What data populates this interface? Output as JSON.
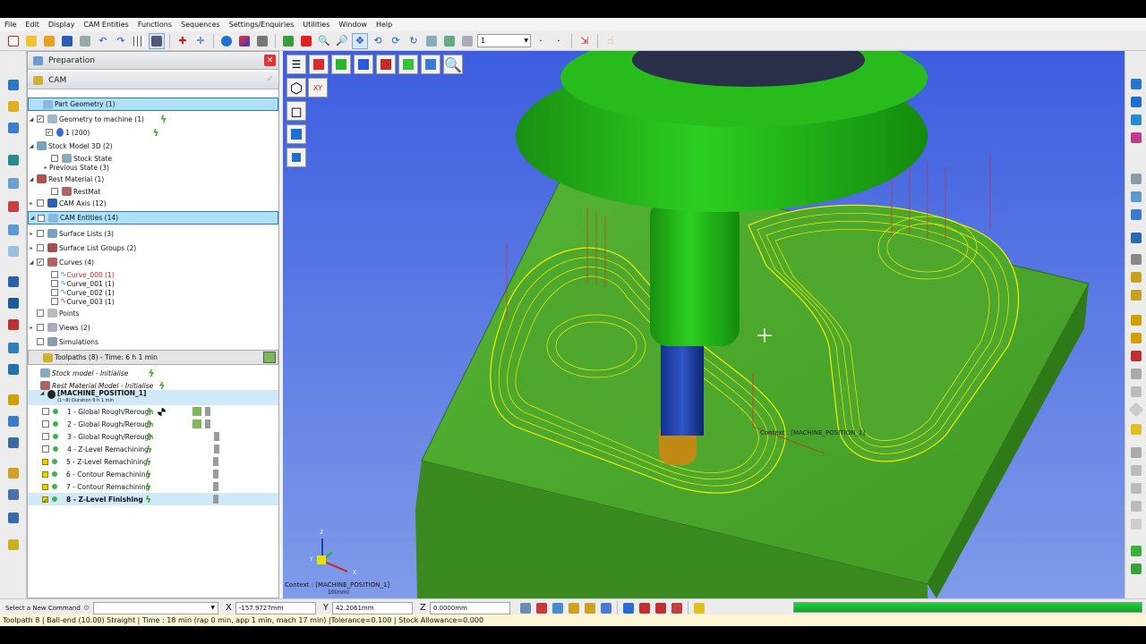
{
  "menu": [
    "File",
    "Edit",
    "Display",
    "CAM Entities",
    "Functions",
    "Sequences",
    "Settings/Enquiries",
    "Utilities",
    "Window",
    "Help"
  ],
  "toolbar": {
    "combo_value": "1"
  },
  "panel": {
    "title": "Preparation",
    "subtitle": "CAM",
    "close_label": "✕",
    "ok_label": "✓"
  },
  "tree": {
    "part_geometry": "Part Geometry (1)",
    "geometry_to_machine": "Geometry to machine (1)",
    "geom_item": "1 (200)",
    "stock_model": "Stock Model 3D (2)",
    "stock_state": "Stock State",
    "previous_state": "Previous State (3)",
    "rest_material": "Rest Material (1)",
    "restmat": "RestMat",
    "cam_axis": "CAM Axis (12)",
    "cam_entities": "CAM Entities (14)",
    "surface_lists": "Surface Lists (3)",
    "surface_list_groups": "Surface List Groups (2)",
    "curves": "Curves (4)",
    "curve_items": [
      "Curve_000 (1)",
      "Curve_001 (1)",
      "Curve_002 (1)",
      "Curve_003 (1)"
    ],
    "points": "Points",
    "views": "Views (2)",
    "simulations": "Simulations",
    "toolpaths": "Toolpaths (8) - Time: 6 h 1 min",
    "stock_init": "Stock model - Initialise",
    "rest_init": "Rest Material Model - Initialise",
    "machine_position": "[MACHINE_POSITION_1]",
    "machine_duration": "(1~8) Duration 6 h 1 min",
    "toolpath_items": [
      "1 - Global Rough/Rerough",
      "2 - Global Rough/Rerough",
      "3 - Global Rough/Rerough",
      "4 - Z-Level Remachining",
      "5 - Z-Level Remachining",
      "6 - Contour Remachining",
      "7 - Contour Remachining",
      "8 - Z-Level Finishing"
    ]
  },
  "viewport": {
    "context_label": "Context : [MACHINE_POSITION_1]",
    "context_label_model": "Context : [MACHINE_POSITION_1]",
    "scale_label": "10(mm)",
    "axis_z": "Z",
    "axis_y": "Y",
    "axis_x": "X",
    "part_color": "#4aa12c",
    "spindle_color": "#22b61a",
    "tool_color": "#1e3fa3",
    "toolpath_color": "#f0f000"
  },
  "command": {
    "label": "Select a New Command",
    "x_label": "X",
    "x_value": "-157.9727mm",
    "y_label": "Y",
    "y_value": "42.2061mm",
    "z_label": "Z",
    "z_value": "0.0000mm",
    "progress_percent": 100
  },
  "status": "Toolpath 8 | Ball-end (10.00) Straight | Time : 18 min (rap 0 min, app 1 min, mach 17 min) |Tolerance=0.100 | Stock Allowance=0.000"
}
